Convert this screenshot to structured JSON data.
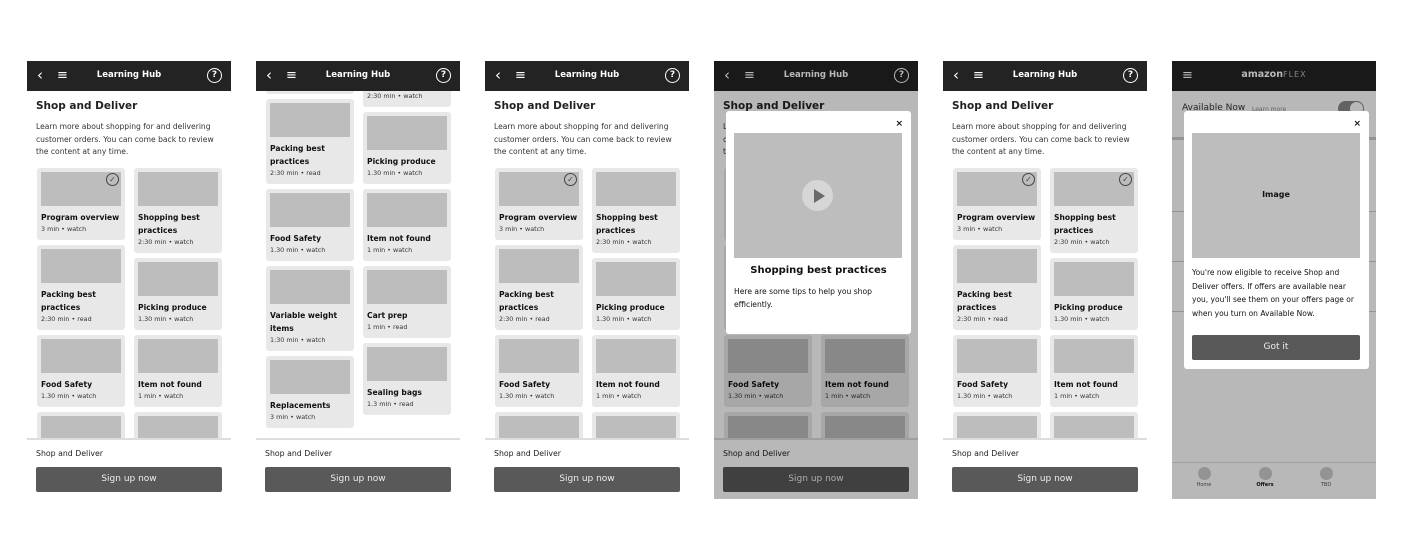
{
  "header": {
    "title": "Learning Hub",
    "back_icon": "chevron-left-icon",
    "menu_icon": "hamburger-icon",
    "help_icon": "question-circle-icon"
  },
  "hub": {
    "heading": "Shop and Deliver",
    "description": "Learn more about shopping for and delivering customer orders. You can come back to review the content at any time.",
    "cards": {
      "left": [
        {
          "title": "Program overview",
          "meta": "3 min • watch"
        },
        {
          "title": "Packing best practices",
          "meta": "2:30 min • read"
        },
        {
          "title": "Food Safety",
          "meta": "1.30 min • watch"
        },
        {
          "title": "Variable weight items",
          "meta": "1:30 min • watch"
        },
        {
          "title": "Replacements",
          "meta": "3 min • watch"
        }
      ],
      "right": [
        {
          "title": "Shopping best practices",
          "meta": "2:30 min • watch"
        },
        {
          "title": "Picking produce",
          "meta": "1.30 min • watch"
        },
        {
          "title": "Item not found",
          "meta": "1 min • watch"
        },
        {
          "title": "Cart prep",
          "meta": "1 min • read"
        },
        {
          "title": "Sealing bags",
          "meta": "1.3 min • read"
        }
      ]
    },
    "footer_label": "Shop and Deliver",
    "signup_label": "Sign up now"
  },
  "video_modal": {
    "title": "Shopping best practices",
    "text": "Here are some tips to help you shop efficiently.",
    "close": "×"
  },
  "flex": {
    "logo_amazon": "amazon",
    "logo_flex": "FLEX",
    "available_now": "Available Now",
    "learn_more": "Learn more",
    "available_toggle_on": true,
    "modal_image_label": "Image",
    "modal_text": "You're now eligible to receive Shop and Deliver offers. If offers are available near you, you'll see them on your offers page or when you turn on Available Now.",
    "got_it": "Got it",
    "close": "×",
    "nav": [
      {
        "label": "Home"
      },
      {
        "label": "Offers",
        "active": true
      },
      {
        "label": "TBD"
      }
    ]
  },
  "screens": [
    {
      "kind": "hub",
      "completed_left": [
        0
      ],
      "completed_right": []
    },
    {
      "kind": "hub-scrolled",
      "completed_left": [],
      "completed_right": []
    },
    {
      "kind": "hub",
      "completed_left": [
        0
      ],
      "completed_right": []
    },
    {
      "kind": "hub-video-modal",
      "completed_left": [
        0
      ],
      "completed_right": []
    },
    {
      "kind": "hub",
      "completed_left": [
        0
      ],
      "completed_right": [
        0
      ]
    },
    {
      "kind": "flex-eligible-modal"
    }
  ]
}
